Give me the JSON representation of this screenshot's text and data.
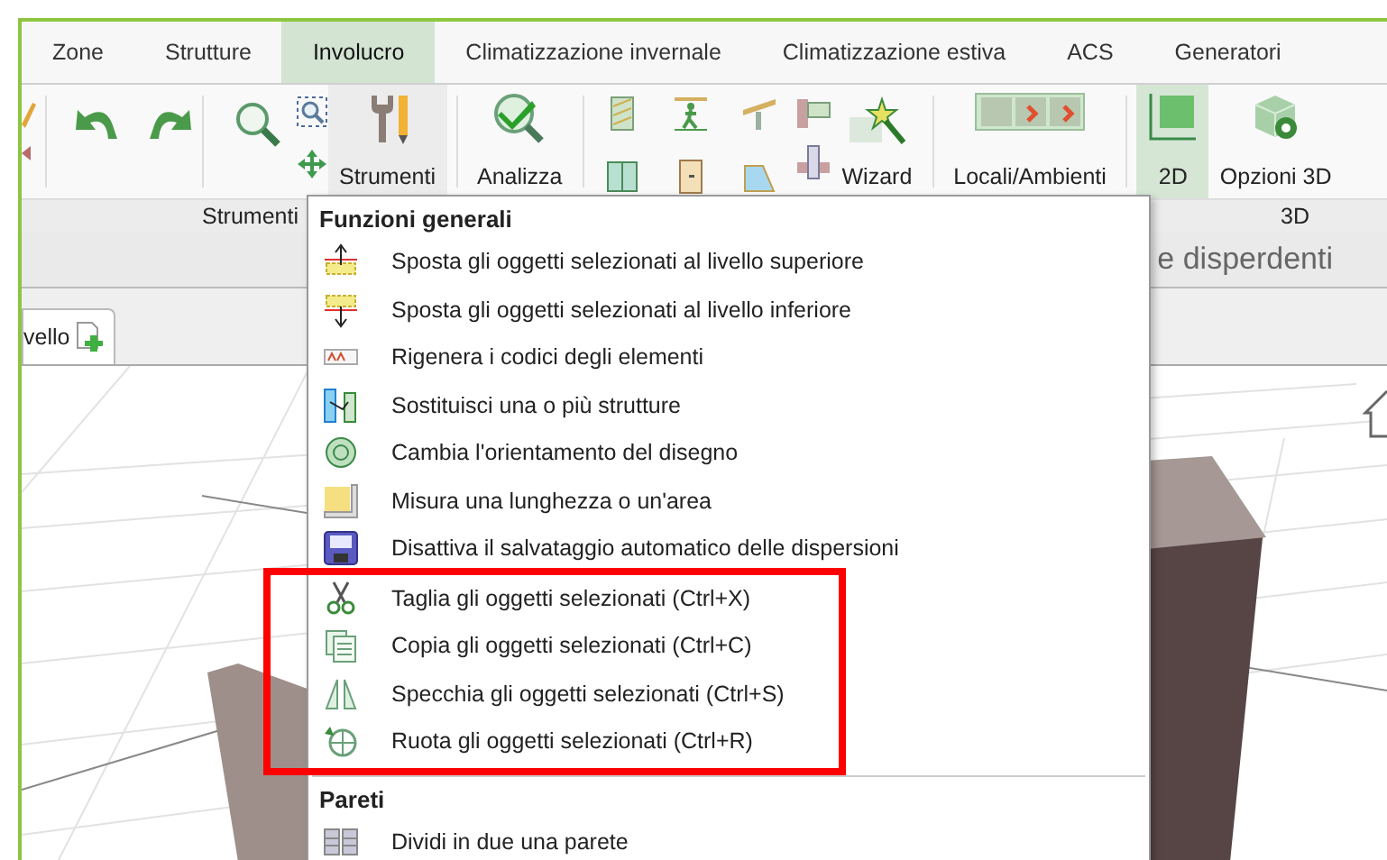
{
  "tabs": [
    {
      "label": "Zone",
      "selected": false
    },
    {
      "label": "Strutture",
      "selected": false
    },
    {
      "label": "Involucro",
      "selected": true
    },
    {
      "label": "Climatizzazione invernale",
      "selected": false
    },
    {
      "label": "Climatizzazione estiva",
      "selected": false
    },
    {
      "label": "ACS",
      "selected": false
    },
    {
      "label": "Generatori",
      "selected": false
    }
  ],
  "ribbon": {
    "buttons": [
      {
        "label": "Strumenti",
        "selected": false,
        "expanded": true
      },
      {
        "label": "Analizza",
        "selected": false,
        "expanded": false
      },
      {
        "label": "Wizard",
        "selected": false,
        "expanded": false
      },
      {
        "label": "Locali/Ambienti",
        "selected": false,
        "expanded": false
      },
      {
        "label": "2D",
        "selected": true,
        "expanded": false
      },
      {
        "label": "Opzioni 3D",
        "selected": false,
        "expanded": false
      }
    ],
    "groups": [
      "Strumenti",
      "3D"
    ]
  },
  "panel_title": "e disperdenti",
  "document_tab": "vello",
  "menu": {
    "sections": [
      {
        "title": "Funzioni generali",
        "items": [
          {
            "label": "Sposta gli oggetti selezionati al livello superiore",
            "highlighted": false
          },
          {
            "label": "Sposta gli oggetti selezionati al livello inferiore",
            "highlighted": false
          },
          {
            "label": "Rigenera i codici degli elementi",
            "highlighted": false
          },
          {
            "label": "Sostituisci una o più strutture",
            "highlighted": false
          },
          {
            "label": "Cambia l'orientamento del disegno",
            "highlighted": false
          },
          {
            "label": "Misura una lunghezza o un'area",
            "highlighted": false
          },
          {
            "label": "Disattiva il salvataggio automatico delle dispersioni",
            "highlighted": false
          },
          {
            "label": "Taglia gli oggetti selezionati (Ctrl+X)",
            "highlighted": true
          },
          {
            "label": "Copia gli oggetti selezionati (Ctrl+C)",
            "highlighted": true
          },
          {
            "label": "Specchia gli oggetti selezionati (Ctrl+S)",
            "highlighted": true
          },
          {
            "label": "Ruota gli oggetti selezionati (Ctrl+R)",
            "highlighted": true
          }
        ]
      },
      {
        "title": "Pareti",
        "items": [
          {
            "label": "Dividi in due una parete",
            "highlighted": false
          }
        ]
      }
    ]
  }
}
